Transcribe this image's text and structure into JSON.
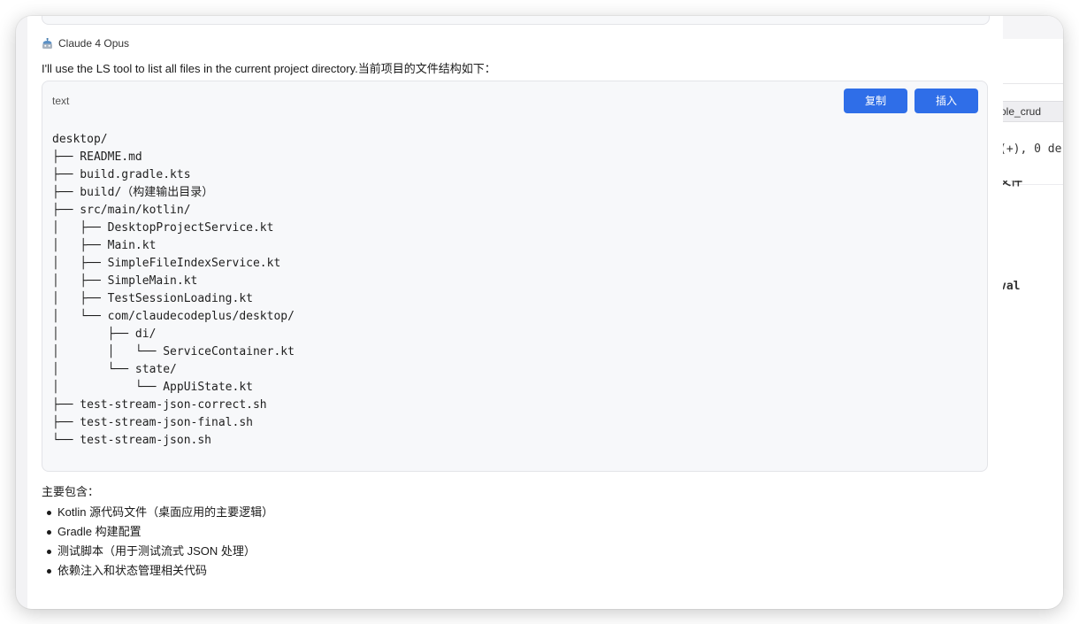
{
  "background_window": {
    "tab_label": "ole_crud",
    "code_line_1": "(+), 0 de",
    "code_line_2": "文件",
    "code_line_3": "val"
  },
  "message": {
    "sender": "Claude 4 Opus",
    "sender_icon": "robot-icon",
    "intro": "I'll use the LS tool to list all files in the current project directory.当前项目的文件结构如下：",
    "code_block": {
      "language": "text",
      "copy_label": "复制",
      "insert_label": "插入",
      "lines": [
        "desktop/",
        "├── README.md",
        "├── build.gradle.kts",
        "├── build/（构建输出目录）",
        "├── src/main/kotlin/",
        "│   ├── DesktopProjectService.kt",
        "│   ├── Main.kt",
        "│   ├── SimpleFileIndexService.kt",
        "│   ├── SimpleMain.kt",
        "│   ├── TestSessionLoading.kt",
        "│   └── com/claudecodeplus/desktop/",
        "│       ├── di/",
        "│       │   └── ServiceContainer.kt",
        "│       └── state/",
        "│           └── AppUiState.kt",
        "├── test-stream-json-correct.sh",
        "├── test-stream-json-final.sh",
        "└── test-stream-json.sh"
      ]
    },
    "summary_title": "主要包含：",
    "summary_items": [
      "Kotlin 源代码文件（桌面应用的主要逻辑）",
      "Gradle 构建配置",
      "测试脚本（用于测试流式 JSON 处理）",
      "依赖注入和状态管理相关代码"
    ]
  },
  "colors": {
    "accent": "#2f6ee8",
    "code_bg": "#f7f8fa",
    "border": "#e3e4e8"
  }
}
